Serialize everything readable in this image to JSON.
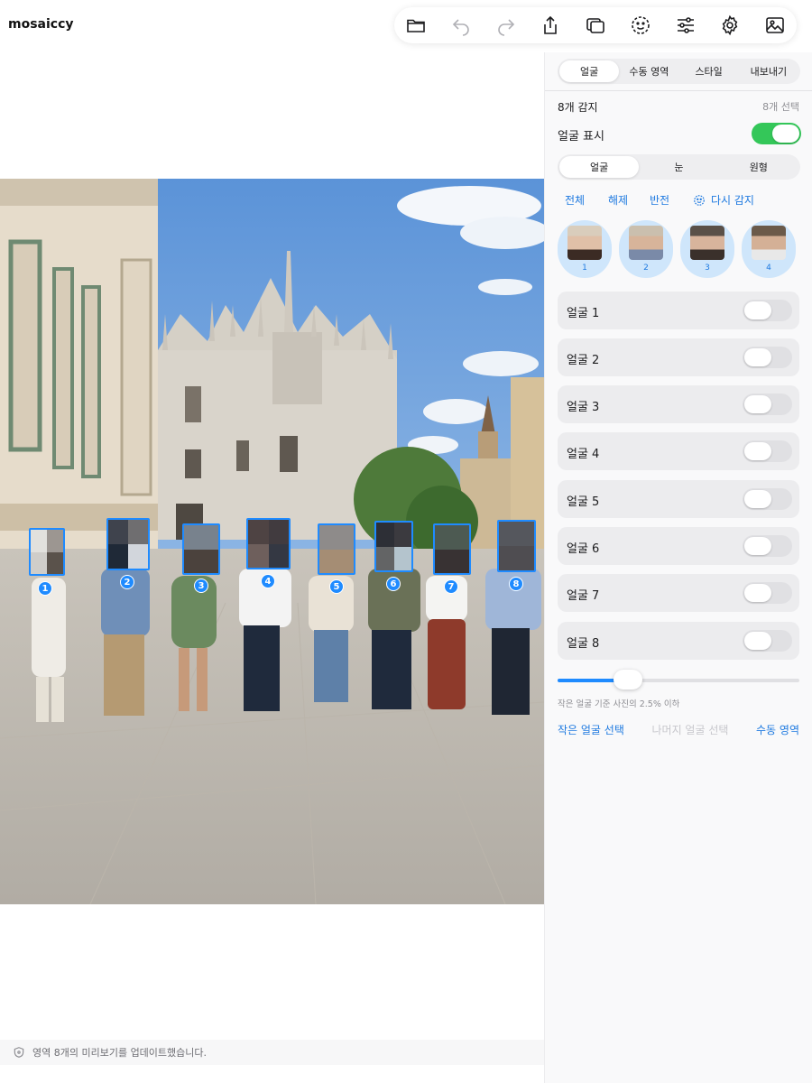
{
  "app": {
    "title": "mosaiccy"
  },
  "toolbar": {
    "items": [
      {
        "icon": "folder-icon"
      },
      {
        "icon": "undo-icon"
      },
      {
        "icon": "redo-icon"
      },
      {
        "icon": "share-icon"
      },
      {
        "icon": "duplicate-icon"
      },
      {
        "icon": "smile-icon"
      },
      {
        "icon": "sliders-icon"
      },
      {
        "icon": "gear-icon"
      },
      {
        "icon": "image-icon"
      }
    ]
  },
  "tabs": [
    {
      "label": "얼굴",
      "active": true
    },
    {
      "label": "수동 영역",
      "active": false
    },
    {
      "label": "스타일",
      "active": false
    },
    {
      "label": "내보내기",
      "active": false
    }
  ],
  "detection": {
    "detected": "8개 감지",
    "selected": "8개 선택",
    "show_faces_label": "얼굴 표시",
    "show_faces_on": true
  },
  "mode_tabs": [
    {
      "label": "얼굴",
      "active": true
    },
    {
      "label": "눈",
      "active": false
    },
    {
      "label": "원형",
      "active": false
    }
  ],
  "actions": {
    "all": "전체",
    "clear": "해제",
    "invert": "반전",
    "redetect": "다시 감지"
  },
  "thumbnails": [
    {
      "num": "1"
    },
    {
      "num": "2"
    },
    {
      "num": "3"
    },
    {
      "num": "4"
    }
  ],
  "faces": [
    {
      "label": "얼굴 1",
      "on": false
    },
    {
      "label": "얼굴 2",
      "on": false
    },
    {
      "label": "얼굴 3",
      "on": false
    },
    {
      "label": "얼굴 4",
      "on": false
    },
    {
      "label": "얼굴 5",
      "on": false
    },
    {
      "label": "얼굴 6",
      "on": false
    },
    {
      "label": "얼굴 7",
      "on": false
    },
    {
      "label": "얼굴 8",
      "on": false
    }
  ],
  "slider": {
    "value_fraction": 0.29,
    "note": "작은 얼굴 기준 사진의 2.5% 이하"
  },
  "bottom_actions": {
    "select_small": "작은 얼굴 선택",
    "select_rest": "나머지 얼굴 선택",
    "manual_area": "수동 영역"
  },
  "face_boxes": [
    {
      "num": "1"
    },
    {
      "num": "2"
    },
    {
      "num": "3"
    },
    {
      "num": "4"
    },
    {
      "num": "5"
    },
    {
      "num": "6"
    },
    {
      "num": "7"
    },
    {
      "num": "8"
    }
  ],
  "status": {
    "text": "영역 8개의 미리보기를 업데이트했습니다."
  },
  "colors": {
    "accent": "#1f8bff",
    "toggle_on": "#34c759"
  }
}
